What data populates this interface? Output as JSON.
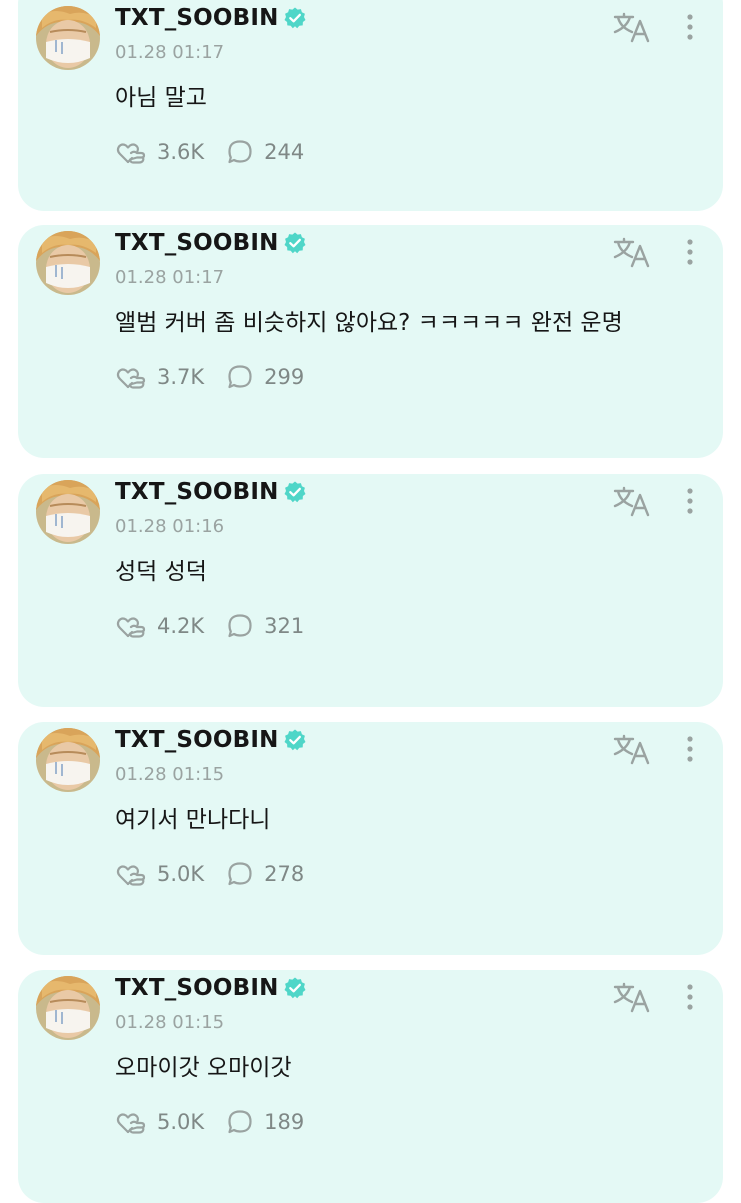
{
  "colors": {
    "card_background": "#e4f9f5",
    "verified_badge": "#4fd6c8",
    "text_primary": "#161616",
    "text_secondary": "#9aa3a1",
    "icon_gray": "#9aa3a1"
  },
  "icons": {
    "reactions": "heart-with-hand-icon",
    "comments": "comment-bubble-icon",
    "translate": "translate-icon",
    "more": "more-vertical-icon",
    "verified": "verified-badge-icon"
  },
  "posts": [
    {
      "username": "TXT_SOOBIN",
      "timestamp": "01.28 01:17",
      "message": "아님 말고",
      "reactions": "3.6K",
      "comments": "244"
    },
    {
      "username": "TXT_SOOBIN",
      "timestamp": "01.28 01:17",
      "message": "앨범 커버 좀 비슷하지 않아요? ㅋㅋㅋㅋㅋ 완전 운명",
      "reactions": "3.7K",
      "comments": "299"
    },
    {
      "username": "TXT_SOOBIN",
      "timestamp": "01.28 01:16",
      "message": "성덕 성덕",
      "reactions": "4.2K",
      "comments": "321"
    },
    {
      "username": "TXT_SOOBIN",
      "timestamp": "01.28 01:15",
      "message": "여기서 만나다니",
      "reactions": "5.0K",
      "comments": "278"
    },
    {
      "username": "TXT_SOOBIN",
      "timestamp": "01.28 01:15",
      "message": "오마이갓 오마이갓",
      "reactions": "5.0K",
      "comments": "189"
    }
  ]
}
